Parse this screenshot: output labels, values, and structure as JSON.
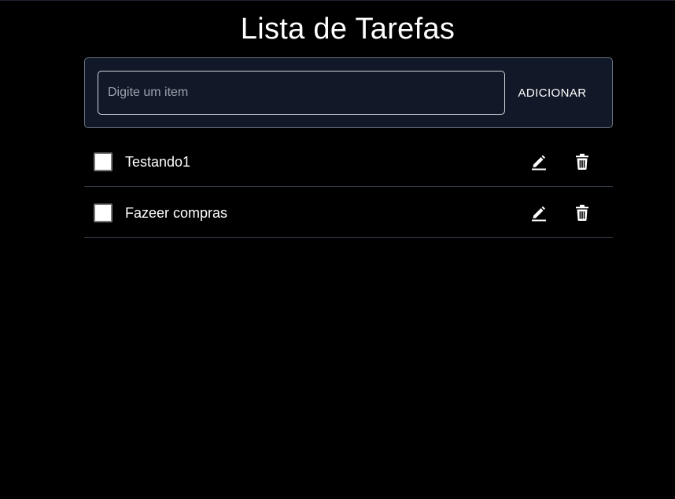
{
  "app": {
    "title": "Lista de Tarefas"
  },
  "form": {
    "placeholder": "Digite um item",
    "value": "",
    "add_label": "ADICIONAR"
  },
  "tasks": [
    {
      "label": "Testando1",
      "checked": false
    },
    {
      "label": "Fazeer compras",
      "checked": false
    }
  ],
  "icons": {
    "edit": "pencil-icon",
    "delete": "trash-icon"
  },
  "colors": {
    "background": "#000000",
    "panel": "#111827",
    "panel_border": "#6b7280",
    "divider": "#374151",
    "placeholder": "#9ca3af",
    "text": "#ffffff"
  }
}
